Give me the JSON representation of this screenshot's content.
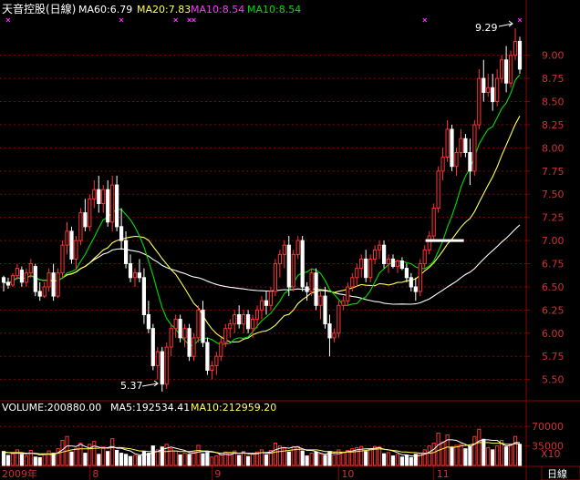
{
  "colors": {
    "up": "#ff3333",
    "down": "#ffffff",
    "ma60": "#ffffff",
    "ma20": "#ffff55",
    "ma10": "#00dd00",
    "ma10_label": "#ff33ff",
    "grid": "#8a0000",
    "axis_text": "#cc3333",
    "marker": "#ff33ff"
  },
  "header": {
    "title": "天音控股(日線)",
    "ma60": "MA60:6.79",
    "ma20": "MA20:7.83",
    "ma10_a": "MA10:8.54",
    "ma10_b": "MA10:8.54"
  },
  "volume_header": {
    "volume": "VOLUME:200880.00",
    "ma5": "MA5:192534.41",
    "ma10": "MA10:212959.20"
  },
  "annotations": {
    "high": "9.29",
    "low": "5.37"
  },
  "x_labels": [
    {
      "text": "2009年",
      "index": 0
    },
    {
      "text": "8",
      "index": 19
    },
    {
      "text": "9",
      "index": 46
    },
    {
      "text": "10",
      "index": 74
    },
    {
      "text": "11",
      "index": 95
    }
  ],
  "period_label": "日線",
  "volume_scale_label": "X10",
  "chart_data": {
    "type": "candlestick",
    "price_ticks": [
      "5.50",
      "5.75",
      "6.00",
      "6.25",
      "6.50",
      "6.75",
      "7.00",
      "7.25",
      "7.50",
      "7.75",
      "8.00",
      "8.25",
      "8.50",
      "8.75",
      "9.00"
    ],
    "volume_ticks": [
      "70000",
      "35000"
    ],
    "price_range": [
      5.3,
      9.4
    ],
    "volume_range": [
      0,
      90000
    ],
    "marker_indices": [
      1,
      26,
      38,
      41,
      42,
      93,
      114
    ],
    "ohlc": [
      [
        6.6,
        6.62,
        6.45,
        6.55
      ],
      [
        6.55,
        6.6,
        6.48,
        6.52
      ],
      [
        6.52,
        6.65,
        6.5,
        6.62
      ],
      [
        6.62,
        6.75,
        6.58,
        6.7
      ],
      [
        6.68,
        6.72,
        6.5,
        6.55
      ],
      [
        6.55,
        6.7,
        6.5,
        6.65
      ],
      [
        6.65,
        6.8,
        6.6,
        6.75
      ],
      [
        6.72,
        6.75,
        6.4,
        6.45
      ],
      [
        6.45,
        6.55,
        6.35,
        6.4
      ],
      [
        6.4,
        6.55,
        6.38,
        6.5
      ],
      [
        6.5,
        6.7,
        6.45,
        6.65
      ],
      [
        6.65,
        6.75,
        6.35,
        6.4
      ],
      [
        6.4,
        6.7,
        6.38,
        6.65
      ],
      [
        6.65,
        7.0,
        6.6,
        6.95
      ],
      [
        6.95,
        7.2,
        6.85,
        7.1
      ],
      [
        7.1,
        7.15,
        6.75,
        6.8
      ],
      [
        6.8,
        7.05,
        6.7,
        7.0
      ],
      [
        7.0,
        7.35,
        6.95,
        7.3
      ],
      [
        7.3,
        7.45,
        7.1,
        7.15
      ],
      [
        7.15,
        7.5,
        7.1,
        7.45
      ],
      [
        7.45,
        7.65,
        7.35,
        7.55
      ],
      [
        7.55,
        7.7,
        7.3,
        7.4
      ],
      [
        7.4,
        7.6,
        7.3,
        7.55
      ],
      [
        7.55,
        7.65,
        7.15,
        7.2
      ],
      [
        7.2,
        7.7,
        7.1,
        7.6
      ],
      [
        7.6,
        7.7,
        7.1,
        7.15
      ],
      [
        7.15,
        7.35,
        6.9,
        7.0
      ],
      [
        7.0,
        7.1,
        6.7,
        6.75
      ],
      [
        6.75,
        6.85,
        6.55,
        6.6
      ],
      [
        6.6,
        6.7,
        6.5,
        6.65
      ],
      [
        6.65,
        6.8,
        6.55,
        6.6
      ],
      [
        6.6,
        6.7,
        6.1,
        6.2
      ],
      [
        6.2,
        6.35,
        6.0,
        6.05
      ],
      [
        6.05,
        6.1,
        5.6,
        5.65
      ],
      [
        5.65,
        5.85,
        5.5,
        5.8
      ],
      [
        5.8,
        5.85,
        5.37,
        5.45
      ],
      [
        5.45,
        5.9,
        5.4,
        5.85
      ],
      [
        5.85,
        6.1,
        5.75,
        6.05
      ],
      [
        6.05,
        6.2,
        5.95,
        6.15
      ],
      [
        6.15,
        6.2,
        5.9,
        5.95
      ],
      [
        5.95,
        6.1,
        5.85,
        6.05
      ],
      [
        6.05,
        6.1,
        5.7,
        5.75
      ],
      [
        5.75,
        6.0,
        5.7,
        5.95
      ],
      [
        5.95,
        6.3,
        5.9,
        6.25
      ],
      [
        6.25,
        6.35,
        5.85,
        5.9
      ],
      [
        5.9,
        5.95,
        5.55,
        5.6
      ],
      [
        5.6,
        5.7,
        5.5,
        5.65
      ],
      [
        5.65,
        5.8,
        5.55,
        5.75
      ],
      [
        5.75,
        5.95,
        5.7,
        5.9
      ],
      [
        5.9,
        6.1,
        5.85,
        6.05
      ],
      [
        6.05,
        6.15,
        5.95,
        6.1
      ],
      [
        6.1,
        6.25,
        6.0,
        6.2
      ],
      [
        6.2,
        6.3,
        6.05,
        6.1
      ],
      [
        6.1,
        6.25,
        6.0,
        6.2
      ],
      [
        6.2,
        6.25,
        6.0,
        6.05
      ],
      [
        6.05,
        6.2,
        5.95,
        6.15
      ],
      [
        6.15,
        6.3,
        6.05,
        6.25
      ],
      [
        6.25,
        6.4,
        6.15,
        6.35
      ],
      [
        6.35,
        6.45,
        6.2,
        6.3
      ],
      [
        6.3,
        6.5,
        6.25,
        6.45
      ],
      [
        6.45,
        6.8,
        6.4,
        6.75
      ],
      [
        6.75,
        6.9,
        6.6,
        6.85
      ],
      [
        6.85,
        7.0,
        6.7,
        6.95
      ],
      [
        6.95,
        7.05,
        6.4,
        6.5
      ],
      [
        6.5,
        6.9,
        6.45,
        6.85
      ],
      [
        6.85,
        7.05,
        6.8,
        7.0
      ],
      [
        7.0,
        7.05,
        6.45,
        6.5
      ],
      [
        6.5,
        6.55,
        6.35,
        6.45
      ],
      [
        6.45,
        6.7,
        6.4,
        6.65
      ],
      [
        6.65,
        6.7,
        6.25,
        6.3
      ],
      [
        6.3,
        6.45,
        6.15,
        6.4
      ],
      [
        6.4,
        6.5,
        6.05,
        6.1
      ],
      [
        6.1,
        6.2,
        5.75,
        5.95
      ],
      [
        5.95,
        6.05,
        5.9,
        6.0
      ],
      [
        6.0,
        6.35,
        5.95,
        6.3
      ],
      [
        6.3,
        6.4,
        6.25,
        6.35
      ],
      [
        6.35,
        6.55,
        6.3,
        6.5
      ],
      [
        6.5,
        6.65,
        6.45,
        6.6
      ],
      [
        6.6,
        6.75,
        6.5,
        6.7
      ],
      [
        6.7,
        6.85,
        6.6,
        6.8
      ],
      [
        6.8,
        6.9,
        6.55,
        6.6
      ],
      [
        6.6,
        6.85,
        6.55,
        6.8
      ],
      [
        6.8,
        6.95,
        6.75,
        6.9
      ],
      [
        6.9,
        7.0,
        6.8,
        6.95
      ],
      [
        6.95,
        7.0,
        6.7,
        6.75
      ],
      [
        6.75,
        6.85,
        6.65,
        6.8
      ],
      [
        6.8,
        6.85,
        6.7,
        6.72
      ],
      [
        6.72,
        6.8,
        6.65,
        6.78
      ],
      [
        6.78,
        6.82,
        6.68,
        6.7
      ],
      [
        6.7,
        6.75,
        6.55,
        6.6
      ],
      [
        6.6,
        6.65,
        6.45,
        6.5
      ],
      [
        6.5,
        6.6,
        6.35,
        6.45
      ],
      [
        6.45,
        6.8,
        6.4,
        6.75
      ],
      [
        6.75,
        6.95,
        6.7,
        6.9
      ],
      [
        6.9,
        7.1,
        6.85,
        7.05
      ],
      [
        7.05,
        7.4,
        7.0,
        7.35
      ],
      [
        7.35,
        7.8,
        7.3,
        7.75
      ],
      [
        7.75,
        8.0,
        7.65,
        7.9
      ],
      [
        7.9,
        8.3,
        7.85,
        8.2
      ],
      [
        8.2,
        8.25,
        7.75,
        7.8
      ],
      [
        7.8,
        8.0,
        7.7,
        7.95
      ],
      [
        7.95,
        8.2,
        7.9,
        8.1
      ],
      [
        8.1,
        8.15,
        7.9,
        7.95
      ],
      [
        7.95,
        8.1,
        7.6,
        7.75
      ],
      [
        7.75,
        8.3,
        7.7,
        8.25
      ],
      [
        8.25,
        8.85,
        8.2,
        8.75
      ],
      [
        8.75,
        8.95,
        8.5,
        8.6
      ],
      [
        8.6,
        8.8,
        8.55,
        8.65
      ],
      [
        8.65,
        8.8,
        8.4,
        8.5
      ],
      [
        8.5,
        8.85,
        8.45,
        8.75
      ],
      [
        8.75,
        9.0,
        8.7,
        8.95
      ],
      [
        8.95,
        9.1,
        8.6,
        8.7
      ],
      [
        8.7,
        9.05,
        8.65,
        9.0
      ],
      [
        9.0,
        9.29,
        8.95,
        9.15
      ],
      [
        9.15,
        9.2,
        8.8,
        8.85
      ]
    ],
    "volume": [
      25000,
      18000,
      21000,
      28000,
      20000,
      17000,
      27000,
      15000,
      14000,
      19000,
      26000,
      22000,
      30000,
      45000,
      52000,
      24000,
      31000,
      40000,
      22000,
      38000,
      43000,
      20000,
      33000,
      25000,
      48000,
      27000,
      22000,
      20000,
      16000,
      18000,
      17000,
      25000,
      22000,
      35000,
      28000,
      33000,
      38000,
      30000,
      26000,
      19000,
      22000,
      20000,
      24000,
      36000,
      21000,
      23000,
      15000,
      17000,
      19000,
      24000,
      22000,
      26000,
      18000,
      25000,
      16000,
      20000,
      24000,
      28000,
      19000,
      27000,
      40000,
      35000,
      31000,
      24000,
      33000,
      34000,
      26000,
      17000,
      22000,
      24000,
      21000,
      18000,
      25000,
      19000,
      28000,
      24000,
      27000,
      30000,
      32000,
      34000,
      25000,
      30000,
      34000,
      33000,
      21000,
      23000,
      17000,
      20000,
      15000,
      18000,
      14000,
      20000,
      22000,
      28000,
      35000,
      40000,
      58000,
      42000,
      55000,
      33000,
      36000,
      38000,
      30000,
      34000,
      52000,
      65000,
      47000,
      32000,
      28000,
      35000,
      45000,
      33000,
      38000,
      52000,
      38000
    ],
    "volume_ma5": [
      24000,
      23000,
      22000,
      22000,
      22000,
      21000,
      22000,
      21000,
      19000,
      20000,
      20000,
      19000,
      23000,
      28000,
      35000,
      35000,
      34000,
      38000,
      34000,
      31000,
      35000,
      33000,
      31000,
      32000,
      34000,
      31000,
      31000,
      28000,
      26000,
      21000,
      19000,
      19000,
      20000,
      23000,
      25000,
      29000,
      31000,
      33000,
      31000,
      29000,
      27000,
      23000,
      22000,
      24000,
      25000,
      25000,
      24000,
      23000,
      19000,
      20000,
      19000,
      22000,
      22000,
      23000,
      21000,
      21000,
      21000,
      23000,
      23000,
      24000,
      28000,
      31000,
      32000,
      31000,
      33000,
      33000,
      30000,
      27000,
      27000,
      25000,
      22000,
      20000,
      22000,
      22000,
      21000,
      23000,
      25000,
      26000,
      28000,
      29000,
      30000,
      30000,
      31000,
      32000,
      29000,
      28000,
      26000,
      23000,
      19000,
      19000,
      17000,
      17000,
      18000,
      20000,
      24000,
      29000,
      37000,
      41000,
      46000,
      46000,
      45000,
      41000,
      38000,
      34000,
      38000,
      44000,
      46000,
      46000,
      45000,
      45000,
      39000,
      35000,
      36000,
      41000,
      41000
    ],
    "volume_ma10": [
      23000,
      23000,
      23000,
      23000,
      23000,
      22000,
      22000,
      22000,
      21000,
      21000,
      21000,
      21000,
      22000,
      24000,
      26000,
      28000,
      29000,
      30000,
      30000,
      30000,
      31000,
      31000,
      32000,
      31000,
      32000,
      32000,
      32000,
      31000,
      30000,
      28000,
      26000,
      26000,
      25000,
      25000,
      25000,
      25000,
      25000,
      26000,
      26000,
      25000,
      25000,
      25000,
      26000,
      27000,
      26000,
      26000,
      25000,
      23000,
      22000,
      23000,
      23000,
      23000,
      22000,
      22000,
      22000,
      22000,
      22000,
      23000,
      22000,
      22000,
      24000,
      25000,
      26000,
      27000,
      28000,
      29000,
      29000,
      28000,
      28000,
      28000,
      27000,
      25000,
      25000,
      24000,
      24000,
      23000,
      24000,
      24000,
      25000,
      26000,
      27000,
      28000,
      29000,
      30000,
      29000,
      28000,
      27000,
      26000,
      24000,
      24000,
      23000,
      23000,
      22000,
      22000,
      22000,
      23000,
      27000,
      30000,
      33000,
      32000,
      33000,
      35000,
      36000,
      37000,
      39000,
      41000,
      41000,
      41000,
      40000,
      40000,
      40000,
      38000,
      38000,
      39000,
      39000
    ]
  }
}
